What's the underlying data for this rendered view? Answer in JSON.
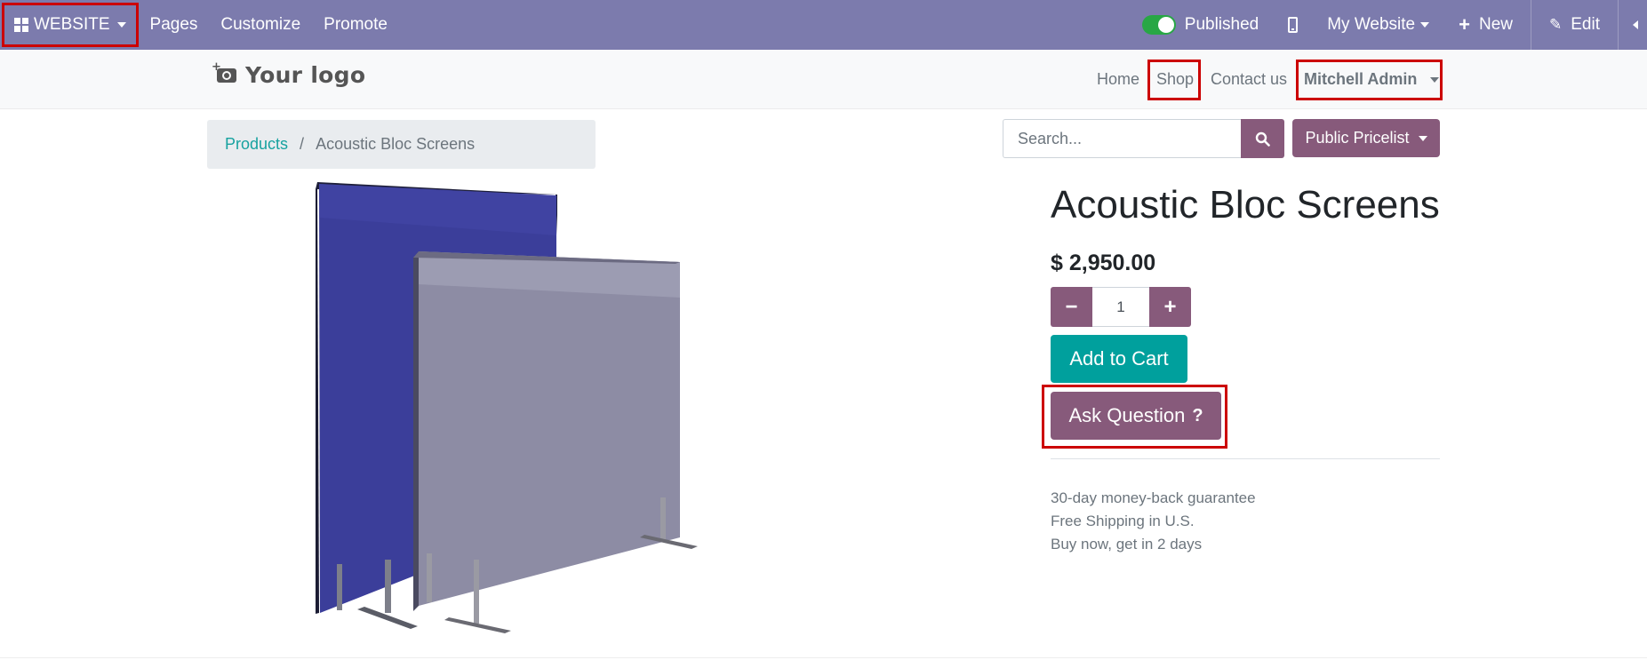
{
  "admin_bar": {
    "apps_label": "WEBSITE",
    "menu": [
      "Pages",
      "Customize",
      "Promote"
    ],
    "published_label": "Published",
    "my_website_label": "My Website",
    "new_label": "New",
    "edit_label": "Edit",
    "background_color": "#7c7bad"
  },
  "header": {
    "logo_text": "Your logo",
    "nav": {
      "home": "Home",
      "shop": "Shop",
      "contact": "Contact us",
      "user": "Mitchell Admin"
    }
  },
  "breadcrumb": {
    "parent": "Products",
    "separator": "/",
    "current": "Acoustic Bloc Screens"
  },
  "search": {
    "placeholder": "Search...",
    "pricelist_label": "Public Pricelist"
  },
  "product": {
    "title": "Acoustic Bloc Screens",
    "price": "$ 2,950.00",
    "quantity": "1",
    "add_to_cart_label": "Add to Cart",
    "ask_question_label": "Ask Question",
    "ask_question_symbol": "?",
    "features": [
      "30-day money-back guarantee",
      "Free Shipping in U.S.",
      "Buy now, get in 2 days"
    ]
  },
  "colors": {
    "primary": "#875a7b",
    "accent": "#00a09d",
    "highlight": "#cc0000"
  }
}
